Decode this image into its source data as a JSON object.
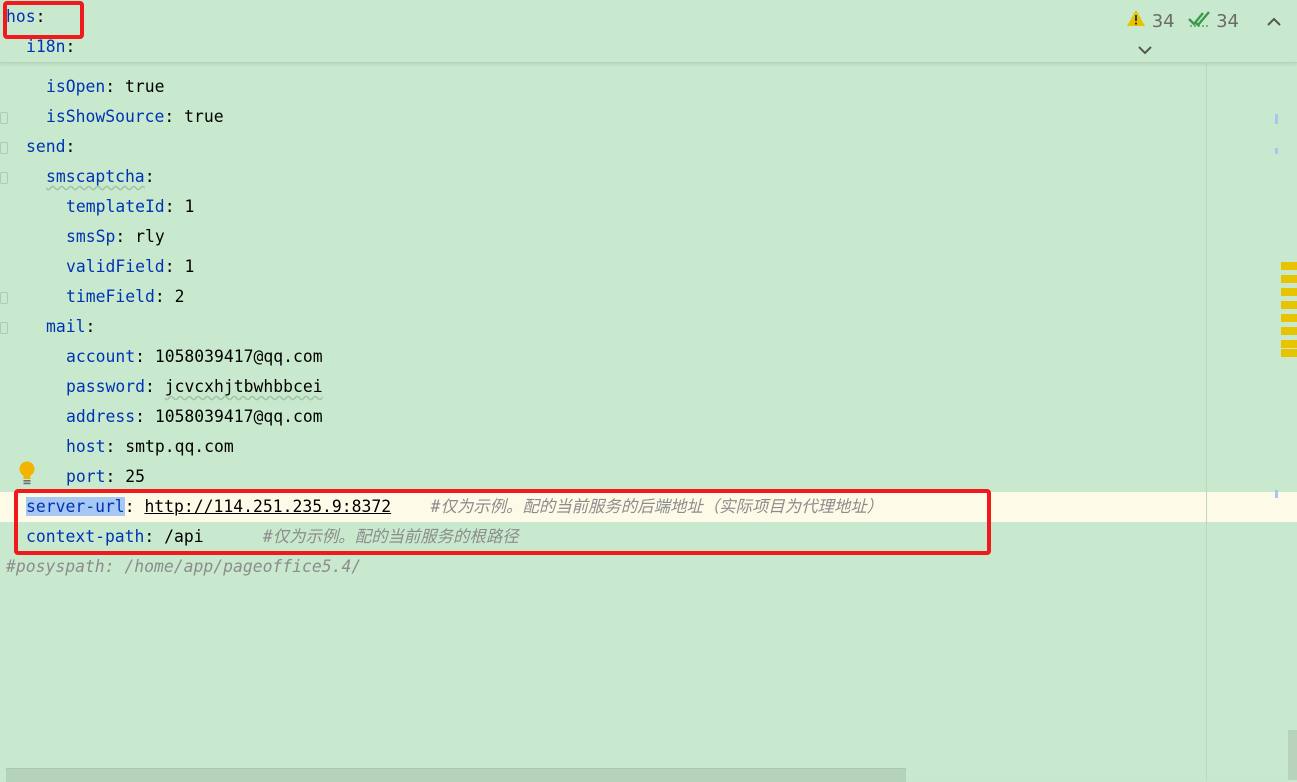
{
  "inspection": {
    "warnings_count": "34",
    "checks_count": "34",
    "warning_icon_color": "#e8c300",
    "check_icon_color": "#3a9a4a"
  },
  "code": {
    "sticky": {
      "hos_key": "hos",
      "i18n_key": "i18n"
    },
    "lines": {
      "isOpen": {
        "key": "isOpen",
        "value": "true"
      },
      "isShowSource": {
        "key": "isShowSource",
        "value": "true"
      },
      "send": {
        "key": "send"
      },
      "smscaptcha": {
        "key": "smscaptcha"
      },
      "templateId": {
        "key": "templateId",
        "value": "1"
      },
      "smsSp": {
        "key": "smsSp",
        "value": "rly"
      },
      "validField": {
        "key": "validField",
        "value": "1"
      },
      "timeField": {
        "key": "timeField",
        "value": "2"
      },
      "mail": {
        "key": "mail"
      },
      "account": {
        "key": "account",
        "value": "1058039417@qq.com"
      },
      "password": {
        "key": "password",
        "value": "jcvcxhjtbwhbbcei"
      },
      "address": {
        "key": "address",
        "value": "1058039417@qq.com"
      },
      "host": {
        "key": "host",
        "value": "smtp.qq.com"
      },
      "port": {
        "key": "port",
        "value": "25"
      },
      "server_url": {
        "key": "server-url",
        "value": "http://114.251.235.9:8372",
        "comment": "#仅为示例。配的当前服务的后端地址（实际项目为代理地址）"
      },
      "context_path": {
        "key": "context-path",
        "value": "/api",
        "comment": "#仅为示例。配的当前服务的根路径"
      },
      "posyspath_comment": "#posyspath: /home/app/pageoffice5.4/"
    }
  },
  "colors": {
    "background": "#c9e9ce",
    "key": "#0033b3",
    "comment": "#8c8c8c",
    "highlight_box": "#f0191c"
  }
}
